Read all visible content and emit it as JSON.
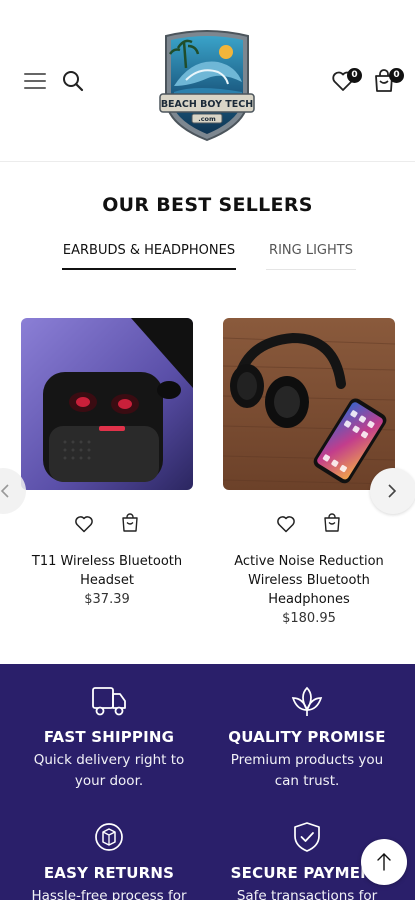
{
  "header": {
    "logo_text_main": "BEACH BOY TECH",
    "logo_text_sub": ".com",
    "wishlist_count": "0",
    "cart_count": "0"
  },
  "best_sellers": {
    "title": "OUR BEST SELLERS",
    "tabs": [
      {
        "label": "EARBUDS & HEADPHONES",
        "active": true
      },
      {
        "label": "RING LIGHTS",
        "active": false
      }
    ]
  },
  "products": [
    {
      "name": "T11 Wireless Bluetooth Headset",
      "price": "$37.39"
    },
    {
      "name": "Active Noise Reduction Wireless Bluetooth Headphones",
      "price": "$180.95"
    }
  ],
  "features": [
    {
      "icon": "truck-icon",
      "title": "FAST SHIPPING",
      "text": "Quick delivery right to your door."
    },
    {
      "icon": "leaf-icon",
      "title": "QUALITY PROMISE",
      "text": "Premium products you can trust."
    },
    {
      "icon": "box-return-icon",
      "title": "EASY RETURNS",
      "text": "Hassle-free process for"
    },
    {
      "icon": "shield-check-icon",
      "title": "SECURE PAYMENT",
      "text": "Safe transactions for"
    }
  ],
  "colors": {
    "features_bg": "#2a1f6a",
    "text_dark": "#111111",
    "accent_blue": "#1f6fa8"
  }
}
